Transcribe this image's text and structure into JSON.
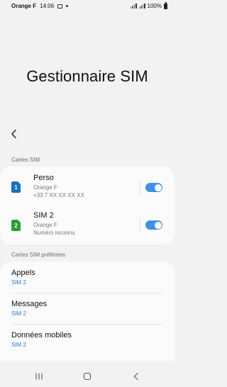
{
  "status_bar": {
    "carrier": "Orange F",
    "time": "14:06",
    "battery": "100%",
    "icons": [
      "gallery-icon",
      "dot-icon",
      "signal-icon",
      "signal-icon",
      "battery-icon"
    ]
  },
  "page": {
    "title": "Gestionnaire SIM",
    "back_icon": "chevron-left-icon"
  },
  "sim_cards": {
    "section_label": "Cartes SIM",
    "items": [
      {
        "badge": "1",
        "badge_color": "#1a6fc2",
        "name": "Perso",
        "operator": "Orange F",
        "number": "+33 7 XX XX XX XX",
        "enabled": true
      },
      {
        "badge": "2",
        "badge_color": "#2e9a3c",
        "name": "SIM 2",
        "operator": "Orange F",
        "number": "Numéro inconnu",
        "enabled": true
      }
    ]
  },
  "preferred": {
    "section_label": "Cartes SIM préférées",
    "items": [
      {
        "title": "Appels",
        "value": "SIM 2"
      },
      {
        "title": "Messages",
        "value": "SIM 2"
      },
      {
        "title": "Données mobiles",
        "value": "SIM 2"
      }
    ]
  },
  "colors": {
    "accent": "#3e91e7",
    "value_text": "#2f77c8",
    "background": "#f2f2f2",
    "card": "#fbfbfb"
  },
  "nav_bar": {
    "icons": [
      "recent-apps-icon",
      "home-icon",
      "back-icon"
    ]
  }
}
